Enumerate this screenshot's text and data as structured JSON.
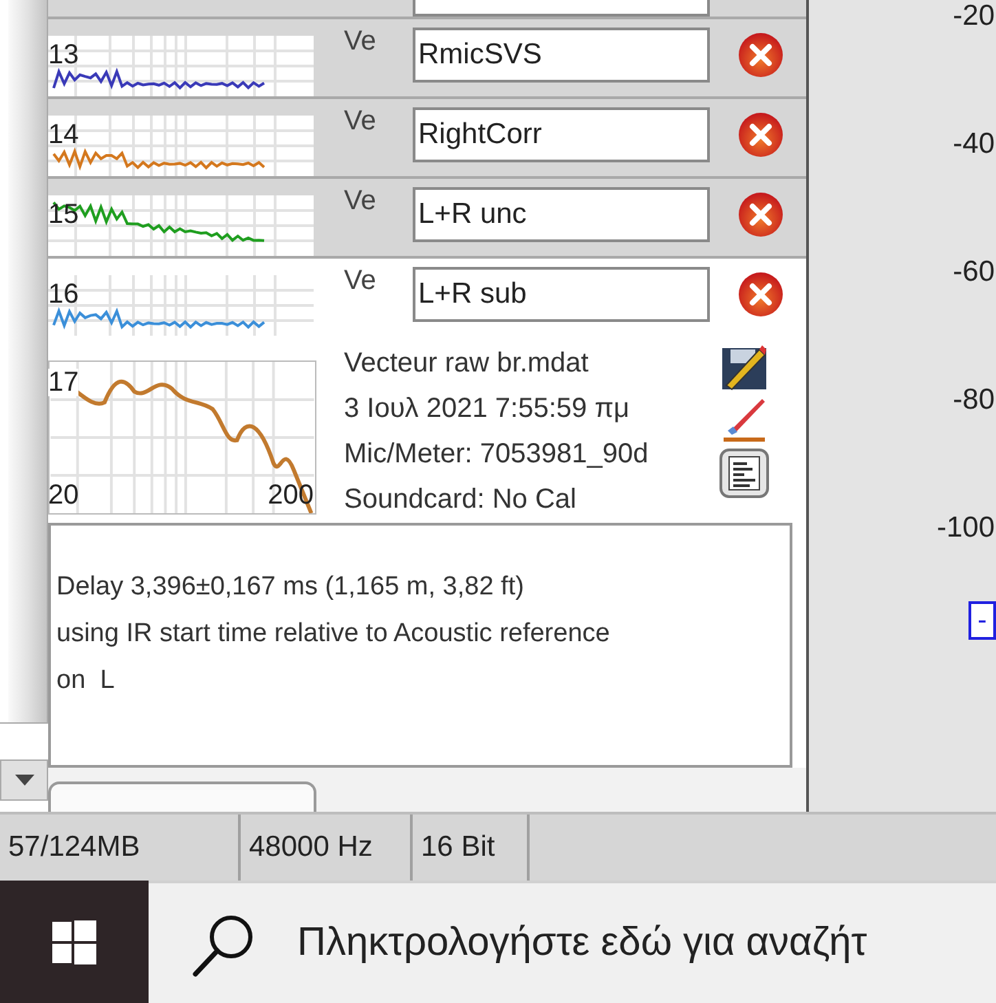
{
  "measurements": [
    {
      "number": "13",
      "label": "Ve",
      "name": "RmicSVS",
      "color": "#3a3ab8",
      "selected": false
    },
    {
      "number": "14",
      "label": "Ve",
      "name": "RightCorr",
      "color": "#d4781e",
      "selected": false
    },
    {
      "number": "15",
      "label": "Ve",
      "name": "L+R unc",
      "color": "#1f9e1f",
      "selected": false
    },
    {
      "number": "16",
      "label": "Ve",
      "name": "L+R sub",
      "color": "#3b8fd9",
      "selected": true
    }
  ],
  "details": {
    "graph_labels": [
      "17",
      "20",
      "200"
    ],
    "lines": [
      "Vecteur raw br.mdat",
      "3 Ιουλ 2021 7:55:59 πμ",
      "Mic/Meter: 7053981_90d",
      "Soundcard: No Cal"
    ],
    "notes": "Delay 3,396±0,167 ms (1,165 m, 3,82 ft)\nusing IR start time relative to Acoustic reference\non  L"
  },
  "axis_labels": [
    "-20",
    "-40",
    "-60",
    "-80",
    "-100"
  ],
  "legend_button": "-",
  "status_bar": [
    "57/124MB",
    "48000 Hz",
    "16 Bit"
  ],
  "taskbar": {
    "search": {
      "placeholder": "Πληκτρολογήστε εδώ για αναζήτ"
    }
  }
}
